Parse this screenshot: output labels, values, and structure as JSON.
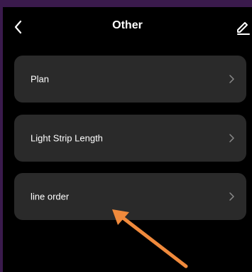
{
  "header": {
    "title": "Other"
  },
  "menu": {
    "items": [
      {
        "label": "Plan"
      },
      {
        "label": "Light Strip Length"
      },
      {
        "label": "line order"
      }
    ]
  },
  "icons": {
    "back": "chevron-left-icon",
    "edit": "pencil-icon",
    "item_chevron": "chevron-right-icon",
    "annotation": "orange-arrow-annotation"
  },
  "colors": {
    "page_background": "#000000",
    "card_background": "#2a2a2a",
    "outer_background": "#3a1a4c",
    "annotation_arrow": "#f08a3c",
    "chevron": "#8a8a8a"
  }
}
